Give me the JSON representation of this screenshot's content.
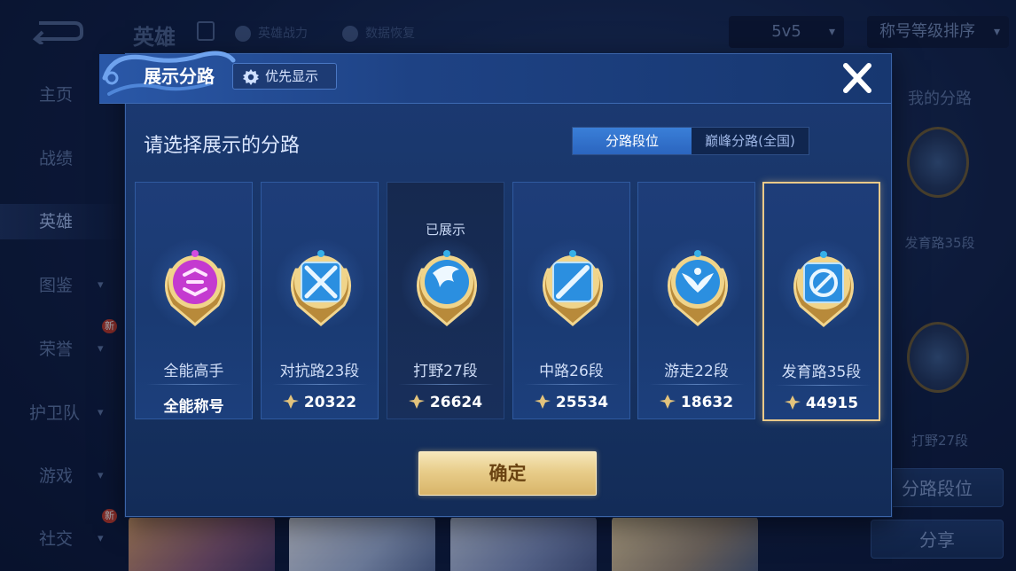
{
  "background": {
    "title": "英雄",
    "links": [
      "英雄战力",
      "数据恢复"
    ],
    "mode_select": "5v5",
    "sort_select": "称号等级排序",
    "nav": [
      {
        "label": "主页",
        "active": false,
        "chevron": false,
        "badge": ""
      },
      {
        "label": "战绩",
        "active": false,
        "chevron": false,
        "badge": ""
      },
      {
        "label": "英雄",
        "active": true,
        "chevron": false,
        "badge": ""
      },
      {
        "label": "图鉴",
        "active": false,
        "chevron": true,
        "badge": ""
      },
      {
        "label": "荣誉",
        "active": false,
        "chevron": true,
        "badge": "新"
      },
      {
        "label": "护卫队",
        "active": false,
        "chevron": true,
        "badge": ""
      },
      {
        "label": "游戏",
        "active": false,
        "chevron": true,
        "badge": ""
      },
      {
        "label": "社交",
        "active": false,
        "chevron": true,
        "badge": "新"
      }
    ],
    "right_panel": {
      "my_lanes": "我的分路",
      "lane1": "发育路35段",
      "lane2": "打野27段",
      "lane_rank_button": "分路段位",
      "share_button": "分享"
    }
  },
  "modal": {
    "title": "展示分路",
    "priority_button": "优先显示",
    "subtitle": "请选择展示的分路",
    "tabs": [
      {
        "label": "分路段位",
        "active": true
      },
      {
        "label": "巅峰分路(全国)",
        "active": false
      }
    ],
    "cards": [
      {
        "name": "全能高手",
        "value": "全能称号",
        "shown": "",
        "emblem": "all-round-emblem-icon",
        "has_points": false,
        "selected": false
      },
      {
        "name": "对抗路23段",
        "value": "20322",
        "shown": "",
        "emblem": "clash-lane-emblem-icon",
        "has_points": true,
        "selected": false
      },
      {
        "name": "打野27段",
        "value": "26624",
        "shown": "已展示",
        "emblem": "jungle-emblem-icon",
        "has_points": true,
        "selected": false
      },
      {
        "name": "中路26段",
        "value": "25534",
        "shown": "",
        "emblem": "mid-lane-emblem-icon",
        "has_points": true,
        "selected": false
      },
      {
        "name": "游走22段",
        "value": "18632",
        "shown": "",
        "emblem": "roam-emblem-icon",
        "has_points": true,
        "selected": false
      },
      {
        "name": "发育路35段",
        "value": "44915",
        "shown": "",
        "emblem": "farm-lane-emblem-icon",
        "has_points": true,
        "selected": true
      }
    ],
    "confirm_button": "确定"
  },
  "colors": {
    "accent_blue": "#2b65bf",
    "gold": "#e8cd8a",
    "selected_border": "#e9c989",
    "all_round_purple": "#c03ad0"
  }
}
